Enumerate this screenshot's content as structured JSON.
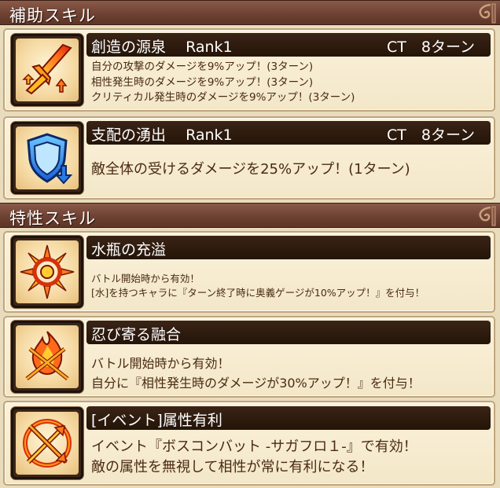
{
  "sections": {
    "support": {
      "title": "補助スキル"
    },
    "trait": {
      "title": "特性スキル"
    }
  },
  "support_skills": [
    {
      "name": "創造の源泉",
      "rank": "Rank1",
      "ct": "CT　8ターン",
      "icon": "flaming-sword-icon",
      "lines": [
        "自分の攻撃のダメージを9%アップ！(3ターン)",
        "相性発生時のダメージを9%アップ！(3ターン)",
        "クリティカル発生時のダメージを9%アップ！(3ターン)"
      ]
    },
    {
      "name": "支配の湧出",
      "rank": "Rank1",
      "ct": "CT　8ターン",
      "icon": "shield-down-icon",
      "lines": [
        "敵全体の受けるダメージを25%アップ！(1ターン)"
      ]
    }
  ],
  "trait_skills": [
    {
      "name": "水瓶の充溢",
      "icon": "radiant-sun-icon",
      "lines": [
        "バトル開始時から有効！",
        "[水]を持つキャラに『ターン終了時に奥義ゲージが10%アップ！』を付与！"
      ]
    },
    {
      "name": "忍び寄る融合",
      "icon": "flame-crossed-arrows-icon",
      "lines": [
        "バトル開始時から有効！",
        "自分に『相性発生時のダメージが30%アップ！』を付与！"
      ]
    },
    {
      "name": "[イベント]属性有利",
      "icon": "crossed-arrows-circle-icon",
      "lines": [
        "イベント『ボスコンバット -サガフロ１-』で有効！",
        "敵の属性を無視して相性が常に有利になる！"
      ]
    }
  ],
  "colors": {
    "header_bg": "#6e4233",
    "name_bar_bg": "#241408",
    "card_bg": "#f8eed3",
    "text": "#4a2a12"
  }
}
